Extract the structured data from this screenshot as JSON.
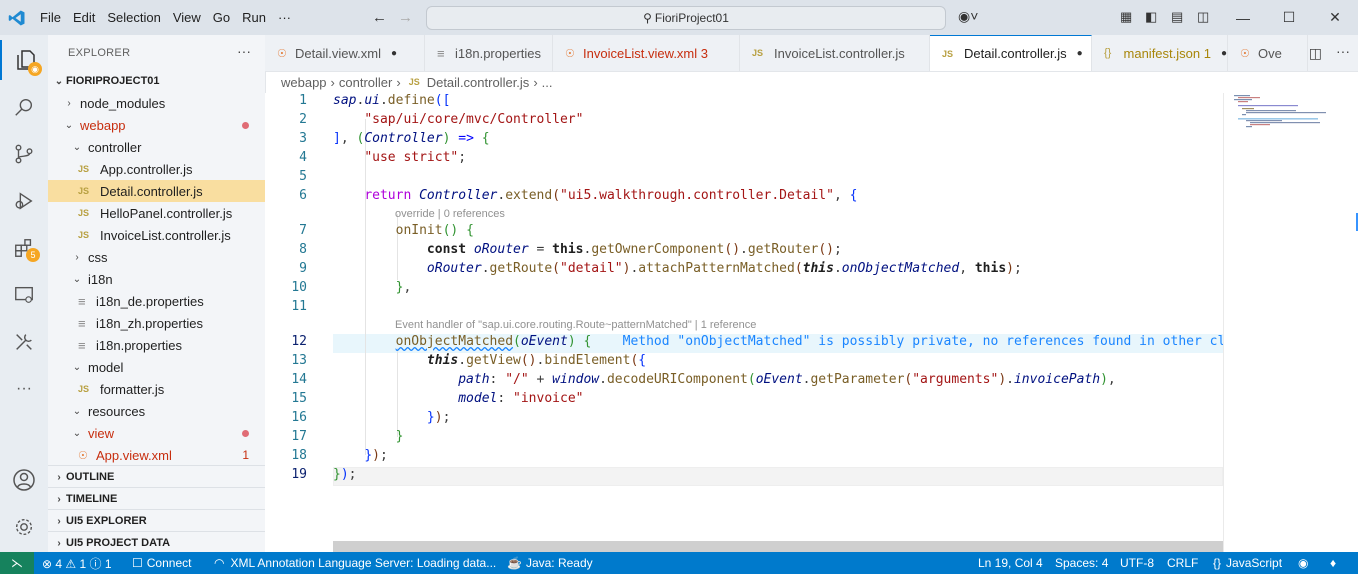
{
  "menu": [
    "File",
    "Edit",
    "Selection",
    "View",
    "Go",
    "Run",
    "···"
  ],
  "search": {
    "text": "FioriProject01"
  },
  "sidebar": {
    "title": "EXPLORER",
    "project": "FIORIPROJECT01",
    "tree": [
      {
        "label": "node_modules",
        "type": "folder",
        "open": false,
        "indent": 1
      },
      {
        "label": "webapp",
        "type": "folder",
        "open": true,
        "indent": 1,
        "red": true,
        "dot": true
      },
      {
        "label": "controller",
        "type": "folder",
        "open": true,
        "indent": 2
      },
      {
        "label": "App.controller.js",
        "type": "js",
        "indent": 3
      },
      {
        "label": "Detail.controller.js",
        "type": "js",
        "indent": 3,
        "selected": true
      },
      {
        "label": "HelloPanel.controller.js",
        "type": "js",
        "indent": 3
      },
      {
        "label": "InvoiceList.controller.js",
        "type": "js",
        "indent": 3
      },
      {
        "label": "css",
        "type": "folder",
        "open": false,
        "indent": 2
      },
      {
        "label": "i18n",
        "type": "folder",
        "open": true,
        "indent": 2
      },
      {
        "label": "i18n_de.properties",
        "type": "props",
        "indent": 3
      },
      {
        "label": "i18n_zh.properties",
        "type": "props",
        "indent": 3
      },
      {
        "label": "i18n.properties",
        "type": "props",
        "indent": 3
      },
      {
        "label": "model",
        "type": "folder",
        "open": true,
        "indent": 2
      },
      {
        "label": "formatter.js",
        "type": "js",
        "indent": 3
      },
      {
        "label": "resources",
        "type": "folder",
        "open": true,
        "indent": 2
      },
      {
        "label": "view",
        "type": "folder",
        "open": true,
        "indent": 2,
        "red": true,
        "dot": true
      },
      {
        "label": "App.view.xml",
        "type": "xml",
        "indent": 3,
        "red": true,
        "count": "1"
      }
    ],
    "sections": [
      "OUTLINE",
      "TIMELINE",
      "UI5 EXPLORER",
      "UI5 PROJECT DATA"
    ]
  },
  "tabs": [
    {
      "label": "Detail.view.xml",
      "icon": "xml",
      "dirty": true
    },
    {
      "label": "i18n.properties",
      "icon": "props",
      "dirty": false
    },
    {
      "label": "InvoiceList.view.xml 3",
      "icon": "xml",
      "dirty": false,
      "red": true
    },
    {
      "label": "InvoiceList.controller.js",
      "icon": "js",
      "dirty": false
    },
    {
      "label": "Detail.controller.js",
      "icon": "js",
      "dirty": true,
      "active": true
    },
    {
      "label": "manifest.json 1",
      "icon": "json",
      "dirty": true,
      "yellow": true
    },
    {
      "label": "Ove",
      "icon": "xml",
      "dirty": false
    }
  ],
  "breadcrumb": [
    "webapp",
    "controller",
    "Detail.controller.js",
    "..."
  ],
  "editor": {
    "line_numbers": [
      "1",
      "2",
      "3",
      "4",
      "5",
      "6",
      "7",
      "8",
      "9",
      "10",
      "11",
      "12",
      "13",
      "14",
      "15",
      "16",
      "17",
      "18",
      "19"
    ],
    "lens_6": "override | 0 references",
    "lens_11": "Event handler of \"sap.ui.core.routing.Route~patternMatched\" | 1 reference",
    "inline_hint": "Method \"onObjectMatched\" is possibly private, no references found in other clas"
  },
  "status": {
    "remote": "✔",
    "problems": "⊗ 4 ⚠ 1 ⓘ 1",
    "connect": "Connect",
    "xml_server": "XML Annotation Language Server: Loading data...",
    "java": "Java: Ready",
    "position": "Ln 19, Col 4",
    "spaces": "Spaces: 4",
    "encoding": "UTF-8",
    "eol": "CRLF",
    "language": "JavaScript"
  },
  "colors": {
    "accent": "#007acc",
    "selection": "#f9dea0",
    "titlebar": "#dde3ea"
  }
}
